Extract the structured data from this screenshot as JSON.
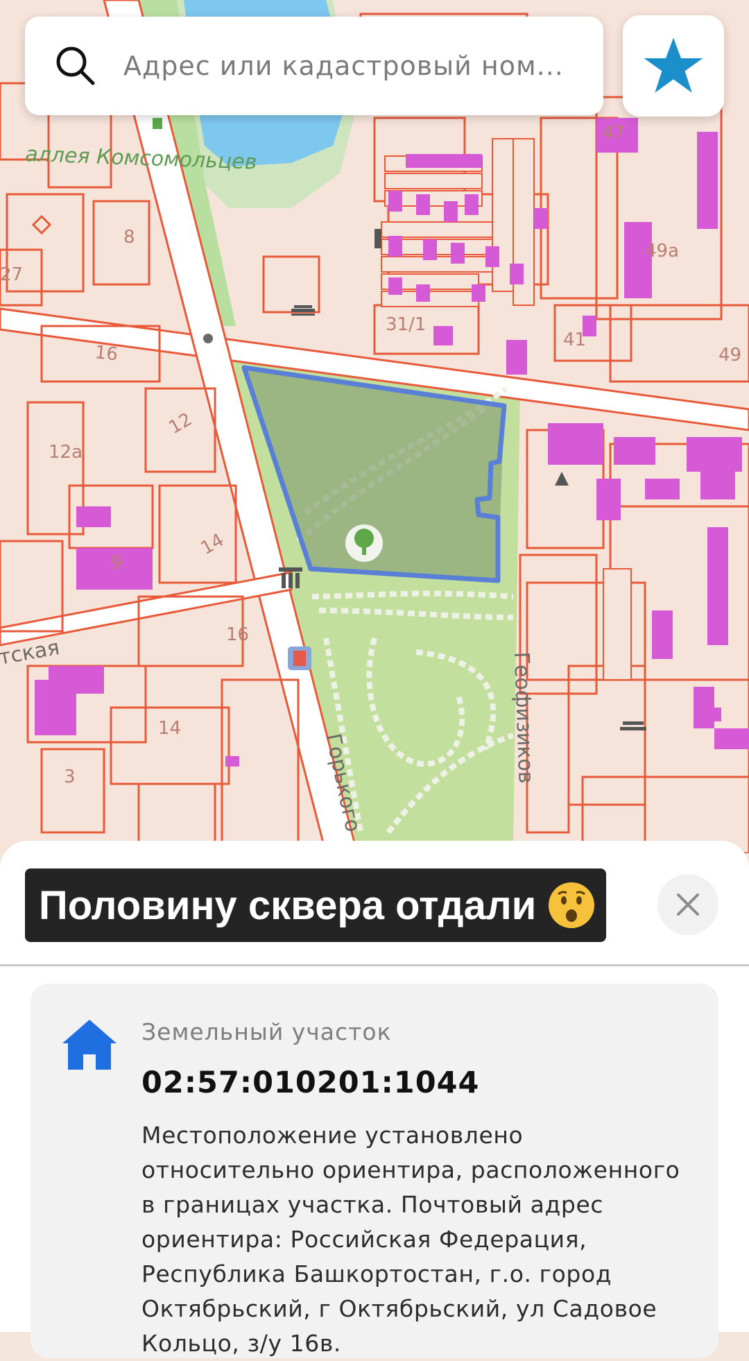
{
  "search": {
    "placeholder": "Адрес или кадастровый ном...",
    "icon": "search-icon"
  },
  "favorites": {
    "icon": "star-icon",
    "color": "#1a8fc9"
  },
  "map": {
    "street_labels": [
      "аллея Комсомольцев",
      "Горького",
      "Геофизиков",
      "тская"
    ],
    "building_numbers": [
      "8",
      "27",
      "16",
      "12а",
      "12",
      "14",
      "9",
      "16",
      "14",
      "3",
      "31/1",
      "41",
      "49",
      "49а",
      "47"
    ],
    "selected_parcel_color": "#5a7fd6",
    "parcel_line_color": "#e8593a",
    "building_color": "#d65ad6"
  },
  "sheet": {
    "caption": "Половину сквера отдали",
    "caption_emoji": "astonished-face-emoji",
    "close_icon": "close-icon",
    "parcel": {
      "type": "Земельный участок",
      "number": "02:57:010201:1044",
      "address": "Местоположение установлено относительно ориентира, расположенного в границах участка. Почтовый адрес ориентира: Российская Федерация, Республика Башкортостан, г.о. город Октябрьский, г Октябрьский, ул Садовое Кольцо, з/у 16в.",
      "icon": "home-icon",
      "icon_color": "#1f6fe0"
    }
  }
}
